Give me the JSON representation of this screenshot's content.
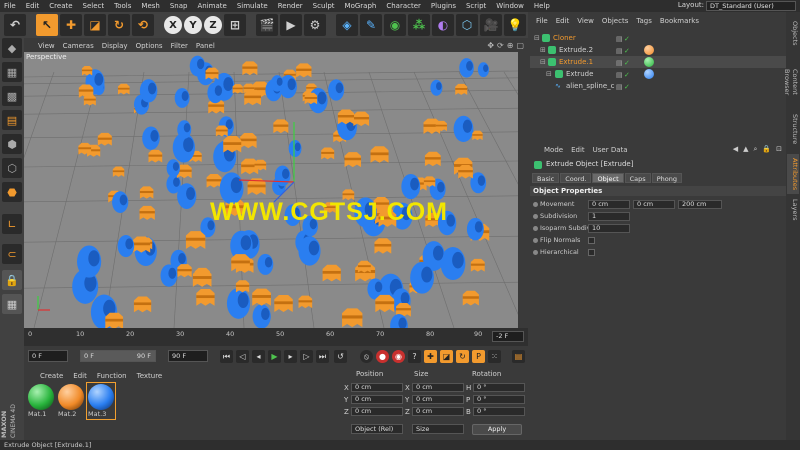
{
  "app": {
    "menus": [
      "File",
      "Edit",
      "Create",
      "Select",
      "Tools",
      "Mesh",
      "Snap",
      "Animate",
      "Simulate",
      "Render",
      "Sculpt",
      "MoGraph",
      "Character",
      "Plugins",
      "Script",
      "Window",
      "Help"
    ],
    "layout_label": "Layout:",
    "layout_value": "DT_Standard (User)",
    "logo_line1": "MAXON",
    "logo_line2": "CINEMA 4D"
  },
  "toolbar": {
    "icons": [
      "undo-icon",
      "cursor-icon",
      "move-icon",
      "scale-icon",
      "rotate-icon",
      "x-axis-icon",
      "y-axis-icon",
      "z-axis-icon",
      "world-coord-icon",
      "render-view-icon",
      "render-picture-icon",
      "render-settings-icon",
      "cube-icon",
      "spline-pen-icon",
      "nurbs-icon",
      "array-icon",
      "deformer-icon",
      "scene-icon",
      "camera-icon",
      "light-icon"
    ],
    "axis_labels": [
      "X",
      "Y",
      "Z"
    ]
  },
  "viewport": {
    "menus": [
      "View",
      "Cameras",
      "Display",
      "Options",
      "Filter",
      "Panel"
    ],
    "label": "Perspective",
    "colors": {
      "orange": "#f29a2e",
      "blue": "#2a7ef0",
      "bg": "#8a8a8a"
    }
  },
  "watermark": "WWW.CGTSJ.COM",
  "timeline": {
    "ticks": [
      "0",
      "10",
      "20",
      "30",
      "40",
      "50",
      "60",
      "70",
      "80",
      "90"
    ],
    "end_frame": "-2 F"
  },
  "playback": {
    "start_field": "0 F",
    "min_field": "0 F",
    "max_field": "90 F",
    "end_field": "90 F"
  },
  "materials": {
    "menus": [
      "Create",
      "Edit",
      "Function",
      "Texture"
    ],
    "items": [
      {
        "name": "Mat.1",
        "color": "#28b43c"
      },
      {
        "name": "Mat.2",
        "color": "#f08a28"
      },
      {
        "name": "Mat.3",
        "color": "#2a7ef0"
      }
    ]
  },
  "coordinates": {
    "headers": {
      "position": "Position",
      "size": "Size",
      "rotation": "Rotation"
    },
    "rows": [
      {
        "axis": "X",
        "pos": "0 cm",
        "size_axis": "X",
        "size": "0 cm",
        "rot_axis": "H",
        "rot": "0 °"
      },
      {
        "axis": "Y",
        "pos": "0 cm",
        "size_axis": "Y",
        "size": "0 cm",
        "rot_axis": "P",
        "rot": "0 °"
      },
      {
        "axis": "Z",
        "pos": "0 cm",
        "size_axis": "Z",
        "size": "0 cm",
        "rot_axis": "B",
        "rot": "0 °"
      }
    ],
    "mode_select": "Object (Rel)",
    "size_select": "Size",
    "apply": "Apply"
  },
  "status": "Extrude Object [Extrude.1]",
  "object_manager": {
    "menus": [
      "File",
      "Edit",
      "View",
      "Objects",
      "Tags",
      "Bookmarks"
    ],
    "rows": [
      {
        "name": "Cloner",
        "color": "#f29a2e",
        "icon": "#3cc070",
        "indent": 0
      },
      {
        "name": "Extrude.2",
        "color": "#d0d0d0",
        "icon": "#3cc070",
        "indent": 1
      },
      {
        "name": "Extrude.1",
        "color": "#f29a2e",
        "icon": "#3cc070",
        "indent": 1
      },
      {
        "name": "Extrude",
        "color": "#d0d0d0",
        "icon": "#3cc070",
        "indent": 2
      },
      {
        "name": "alien_spline_c",
        "color": "#d0d0d0",
        "icon": "#5ab4ff",
        "indent": 2
      }
    ]
  },
  "attributes": {
    "menus": [
      "Mode",
      "Edit",
      "User Data"
    ],
    "title": "Extrude Object [Extrude]",
    "tabs": [
      "Basic",
      "Coord.",
      "Object",
      "Caps",
      "Phong"
    ],
    "active_tab": "Object",
    "section": "Object Properties",
    "props": [
      {
        "label": "Movement",
        "values": [
          "0 cm",
          "0 cm",
          "200 cm"
        ]
      },
      {
        "label": "Subdivision",
        "values": [
          "1"
        ]
      },
      {
        "label": "Isoparm Subdivision",
        "values": [
          "10"
        ]
      },
      {
        "label": "Flip Normals",
        "values": []
      },
      {
        "label": "Hierarchical",
        "values": []
      }
    ]
  },
  "right_tabs": [
    "Objects",
    "Content Browser",
    "Structure",
    "Attributes",
    "Layers"
  ]
}
